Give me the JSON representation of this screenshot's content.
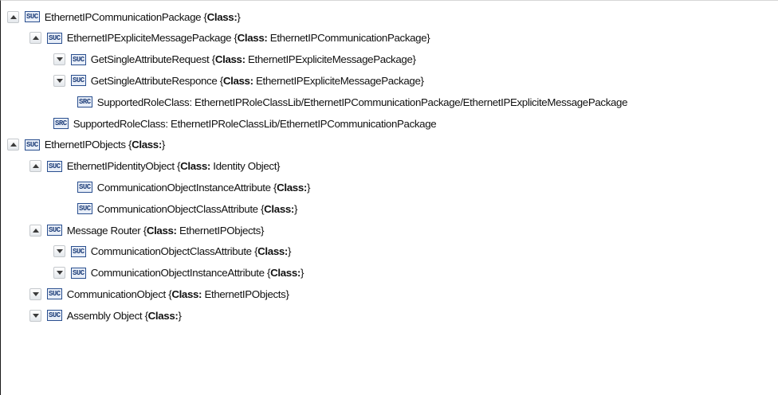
{
  "tree": {
    "nodes": [
      {
        "toggle": "expanded",
        "badge": "SUC",
        "name": "EthernetIPCommunicationPackage",
        "open": " {",
        "class_label": "Class:",
        "class_value": "",
        "close": "}"
      },
      {
        "toggle": "expanded",
        "badge": "SUC",
        "name": "EthernetIPExpliciteMessagePackage",
        "open": " {",
        "class_label": "Class:",
        "class_value": " EthernetIPCommunicationPackage",
        "close": "}"
      },
      {
        "toggle": "collapsed",
        "badge": "SUC",
        "name": "GetSingleAttributeRequest",
        "open": " {",
        "class_label": "Class:",
        "class_value": " EthernetIPExpliciteMessagePackage",
        "close": "}"
      },
      {
        "toggle": "collapsed",
        "badge": "SUC",
        "name": "GetSingleAttributeResponce",
        "open": " {",
        "class_label": "Class:",
        "class_value": " EthernetIPExpliciteMessagePackage",
        "close": "}"
      },
      {
        "toggle": "none",
        "badge": "SRC",
        "name": "SupportedRoleClass: EthernetIPRoleClassLib/EthernetIPCommunicationPackage/EthernetIPExpliciteMessagePackage"
      },
      {
        "toggle": "none",
        "badge": "SRC",
        "name": "SupportedRoleClass: EthernetIPRoleClassLib/EthernetIPCommunicationPackage"
      },
      {
        "toggle": "expanded",
        "badge": "SUC",
        "name": "EthernetIPObjects",
        "open": " {",
        "class_label": "Class:",
        "class_value": "",
        "close": "}"
      },
      {
        "toggle": "expanded",
        "badge": "SUC",
        "name": "EthernetIPidentityObject",
        "open": " {",
        "class_label": "Class:",
        "class_value": " Identity Object",
        "close": "}"
      },
      {
        "toggle": "none",
        "badge": "SUC",
        "name": "CommunicationObjectInstanceAttribute",
        "open": " {",
        "class_label": "Class:",
        "class_value": "",
        "close": "}"
      },
      {
        "toggle": "none",
        "badge": "SUC",
        "name": "CommunicationObjectClassAttribute",
        "open": " {",
        "class_label": "Class:",
        "class_value": "",
        "close": "}"
      },
      {
        "toggle": "expanded",
        "badge": "SUC",
        "name": "Message Router",
        "open": " {",
        "class_label": "Class:",
        "class_value": " EthernetIPObjects",
        "close": "}"
      },
      {
        "toggle": "collapsed",
        "badge": "SUC",
        "name": "CommunicationObjectClassAttribute",
        "open": " {",
        "class_label": "Class:",
        "class_value": "",
        "close": "}"
      },
      {
        "toggle": "collapsed",
        "badge": "SUC",
        "name": "CommunicationObjectInstanceAttribute",
        "open": " {",
        "class_label": "Class:",
        "class_value": "",
        "close": "}"
      },
      {
        "toggle": "collapsed",
        "badge": "SUC",
        "name": "CommunicationObject",
        "open": " {",
        "class_label": "Class:",
        "class_value": " EthernetIPObjects",
        "close": "}"
      },
      {
        "toggle": "collapsed",
        "badge": "SUC",
        "name": "Assembly Object",
        "open": " {",
        "class_label": "Class:",
        "class_value": "",
        "close": "}"
      }
    ]
  }
}
